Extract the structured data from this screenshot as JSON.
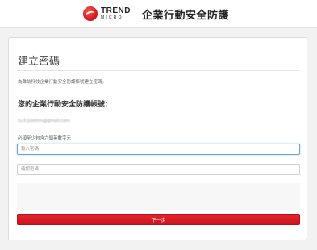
{
  "header": {
    "brand_trend": "TREND",
    "brand_micro": "MICRO",
    "product_name": "企業行動安全防護"
  },
  "card": {
    "title": "建立密碼",
    "instruction": "為難劫科技企業行動安全防護帳號建立密碼。",
    "account_label": "您的企業行動安全防護帳號：",
    "email": "tu.li.justinn@gmail.com",
    "requirement": "必須至少包含六個英數字元",
    "password_field": {
      "placeholder": "輸入密碼",
      "value": ""
    },
    "confirm_field": {
      "placeholder": "確認密碼",
      "value": ""
    },
    "next_button_label": "下一步"
  },
  "colors": {
    "brand_red": "#d71920",
    "focus_blue": "#6aa6d8",
    "background": "#f2f2f2"
  }
}
